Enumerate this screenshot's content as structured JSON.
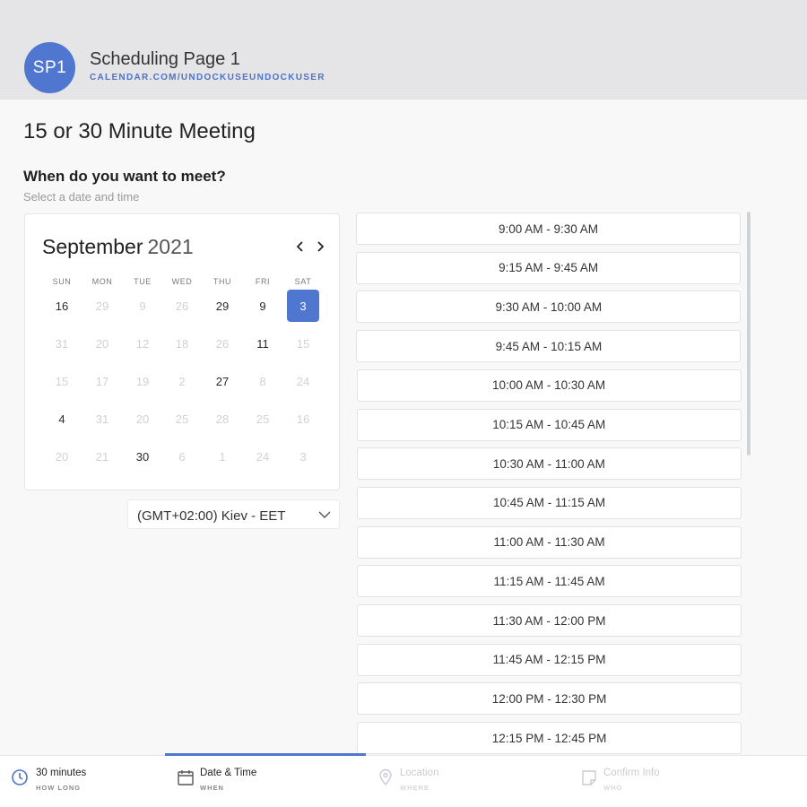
{
  "header": {
    "avatar_initials": "SP1",
    "page_name": "Scheduling Page 1",
    "page_url": "CALENDAR.COM/UNDOCKUSEUNDOCKUSER"
  },
  "meeting": {
    "title": "15 or 30 Minute Meeting",
    "question": "When do you want to meet?",
    "subtitle": "Select a date and time"
  },
  "calendar": {
    "month": "September",
    "year": "2021",
    "prev_icon": "chevron-left-icon",
    "next_icon": "chevron-right-icon",
    "weekdays": [
      "SUN",
      "MON",
      "TUE",
      "WED",
      "THU",
      "FRI",
      "SAT"
    ],
    "weeks": [
      [
        {
          "d": "16",
          "s": "avail"
        },
        {
          "d": "29",
          "s": "off"
        },
        {
          "d": "9",
          "s": "off"
        },
        {
          "d": "26",
          "s": "off"
        },
        {
          "d": "29",
          "s": "avail"
        },
        {
          "d": "9",
          "s": "avail"
        },
        {
          "d": "3",
          "s": "selected"
        }
      ],
      [
        {
          "d": "31",
          "s": "off"
        },
        {
          "d": "20",
          "s": "off"
        },
        {
          "d": "12",
          "s": "off"
        },
        {
          "d": "18",
          "s": "off"
        },
        {
          "d": "26",
          "s": "off"
        },
        {
          "d": "11",
          "s": "avail"
        },
        {
          "d": "15",
          "s": "off"
        }
      ],
      [
        {
          "d": "15",
          "s": "off"
        },
        {
          "d": "17",
          "s": "off"
        },
        {
          "d": "19",
          "s": "off"
        },
        {
          "d": "2",
          "s": "off"
        },
        {
          "d": "27",
          "s": "avail"
        },
        {
          "d": "8",
          "s": "off"
        },
        {
          "d": "24",
          "s": "off"
        }
      ],
      [
        {
          "d": "4",
          "s": "avail"
        },
        {
          "d": "31",
          "s": "off"
        },
        {
          "d": "20",
          "s": "off"
        },
        {
          "d": "25",
          "s": "off"
        },
        {
          "d": "28",
          "s": "off"
        },
        {
          "d": "25",
          "s": "off"
        },
        {
          "d": "16",
          "s": "off"
        }
      ],
      [
        {
          "d": "20",
          "s": "off"
        },
        {
          "d": "21",
          "s": "off"
        },
        {
          "d": "30",
          "s": "avail"
        },
        {
          "d": "6",
          "s": "off"
        },
        {
          "d": "1",
          "s": "off"
        },
        {
          "d": "24",
          "s": "off"
        },
        {
          "d": "3",
          "s": "off"
        }
      ]
    ]
  },
  "timezone": {
    "selected": "(GMT+02:00) Kiev - EET",
    "icon": "chevron-down-icon"
  },
  "time_slots": [
    "9:00 AM - 9:30 AM",
    "9:15 AM - 9:45 AM",
    "9:30 AM - 10:00 AM",
    "9:45 AM - 10:15 AM",
    "10:00 AM - 10:30 AM",
    "10:15 AM - 10:45 AM",
    "10:30 AM - 11:00 AM",
    "10:45 AM - 11:15 AM",
    "11:00 AM - 11:30 AM",
    "11:15 AM - 11:45 AM",
    "11:30 AM - 12:00 PM",
    "11:45 AM - 12:15 PM",
    "12:00 PM - 12:30 PM",
    "12:15 PM - 12:45 PM"
  ],
  "steps": [
    {
      "label": "30 minutes",
      "sub": "HOW LONG",
      "icon": "clock-icon",
      "state": "done"
    },
    {
      "label": "Date & Time",
      "sub": "WHEN",
      "icon": "calendar-icon",
      "state": "active"
    },
    {
      "label": "Location",
      "sub": "WHERE",
      "icon": "location-pin-icon",
      "state": "todo"
    },
    {
      "label": "Confirm Info",
      "sub": "WHO",
      "icon": "note-icon",
      "state": "todo"
    }
  ],
  "colors": {
    "accent": "#5077cf",
    "header_bg": "#e5e5e7",
    "url_text": "#4c73c9"
  }
}
